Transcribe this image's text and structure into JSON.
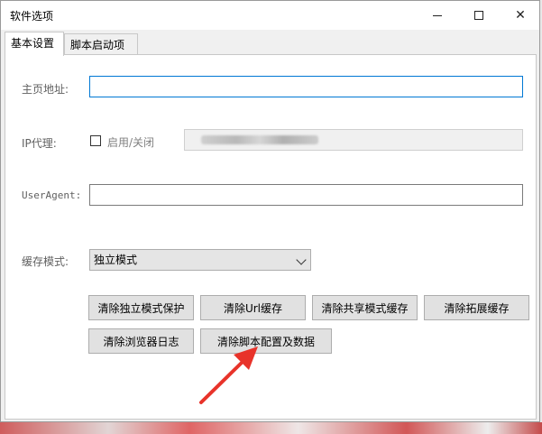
{
  "window": {
    "title": "软件选项"
  },
  "tabs": [
    {
      "label": "基本设置",
      "active": true
    },
    {
      "label": "脚本启动项",
      "active": false
    }
  ],
  "form": {
    "homepage_label": "主页地址:",
    "homepage_value": "",
    "proxy_label": "IP代理:",
    "proxy_toggle_label": "启用/关闭",
    "proxy_enabled": false,
    "useragent_label": "UserAgent:",
    "useragent_value": "",
    "cache_label": "缓存模式:",
    "cache_selected": "独立模式"
  },
  "buttons": {
    "clear_independent": "清除独立模式保护",
    "clear_url": "清除Url缓存",
    "clear_shared": "清除共享模式缓存",
    "clear_extension": "清除拓展缓存",
    "clear_browser_log": "清除浏览器日志",
    "clear_script_config": "清除脚本配置及数据"
  },
  "colors": {
    "focus_border": "#0078d4",
    "annotation_arrow": "#e8332a"
  }
}
